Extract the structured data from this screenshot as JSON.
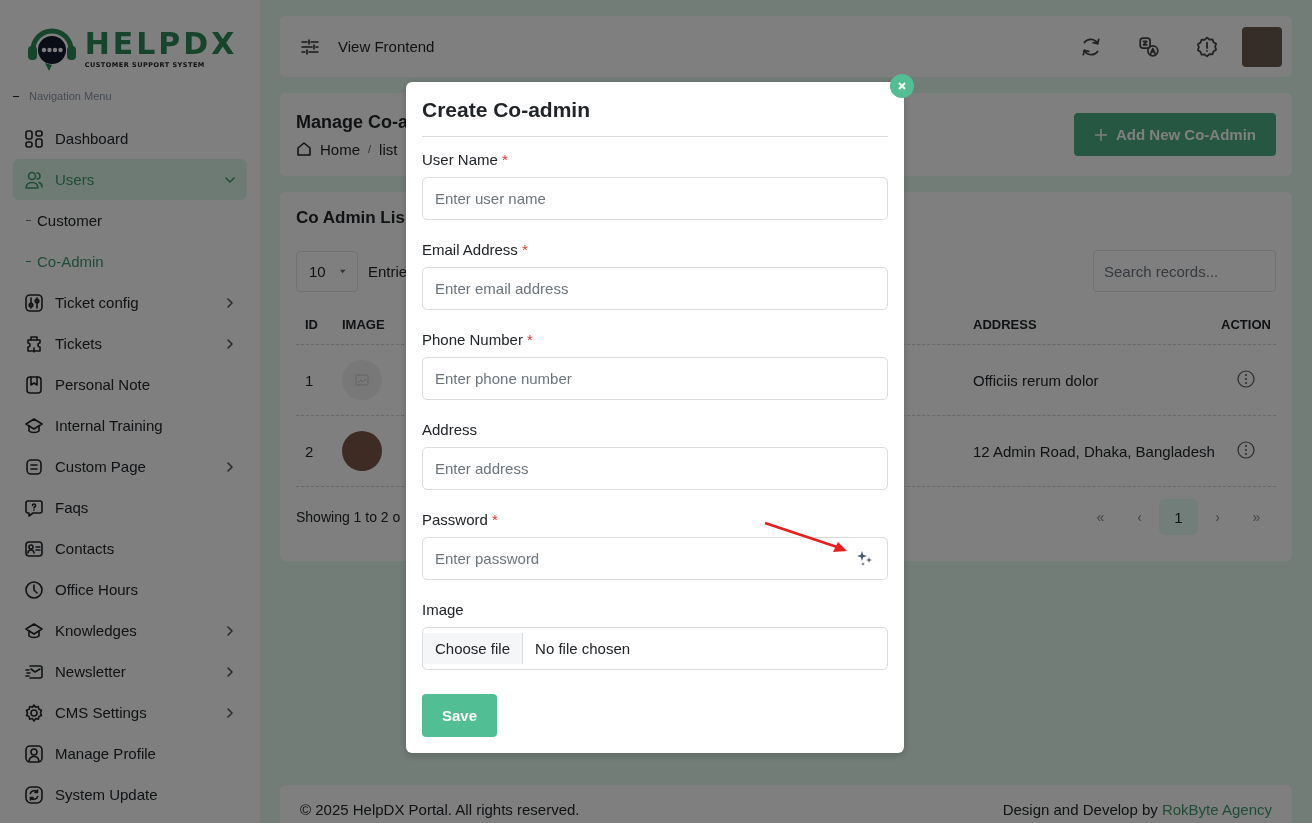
{
  "logo": {
    "name": "HELPDX",
    "tagline": "CUSTOMER SUPPORT SYSTEM"
  },
  "sidebar": {
    "heading": "Navigation Menu",
    "items": [
      {
        "label": "Dashboard",
        "selected": false,
        "has_submenu": false
      },
      {
        "label": "Users",
        "selected": true,
        "has_submenu": true,
        "expanded": true,
        "children": [
          {
            "label": "Customer",
            "selected": false
          },
          {
            "label": "Co-Admin",
            "selected": true
          }
        ]
      },
      {
        "label": "Ticket config",
        "selected": false,
        "has_submenu": true,
        "expanded": false
      },
      {
        "label": "Tickets",
        "selected": false,
        "has_submenu": true,
        "expanded": false
      },
      {
        "label": "Personal Note",
        "selected": false,
        "has_submenu": false
      },
      {
        "label": "Internal Training",
        "selected": false,
        "has_submenu": false
      },
      {
        "label": "Custom Page",
        "selected": false,
        "has_submenu": true,
        "expanded": false
      },
      {
        "label": "Faqs",
        "selected": false,
        "has_submenu": false
      },
      {
        "label": "Contacts",
        "selected": false,
        "has_submenu": false
      },
      {
        "label": "Office Hours",
        "selected": false,
        "has_submenu": false
      },
      {
        "label": "Knowledges",
        "selected": false,
        "has_submenu": true,
        "expanded": false
      },
      {
        "label": "Newsletter",
        "selected": false,
        "has_submenu": true,
        "expanded": false
      },
      {
        "label": "CMS Settings",
        "selected": false,
        "has_submenu": true,
        "expanded": false
      },
      {
        "label": "Manage Profile",
        "selected": false,
        "has_submenu": false
      },
      {
        "label": "System Update",
        "selected": false,
        "has_submenu": false
      }
    ]
  },
  "topbar": {
    "link": "View Frontend"
  },
  "page_header": {
    "title": "Manage Co-a",
    "breadcrumb": [
      "Home",
      "list"
    ],
    "breadcrumb_separator": "/",
    "button": "Add New Co-Admin"
  },
  "list": {
    "title": "Co Admin Lis",
    "page_size": "10",
    "entries_label": "Entrie",
    "search_placeholder": "Search records...",
    "table": {
      "columns": [
        "ID",
        "IMAGE",
        "ADDRESS",
        "ACTION"
      ],
      "rows": [
        {
          "id": "1",
          "kind": "placeholder",
          "address": "Officiis rerum dolor"
        },
        {
          "id": "2",
          "kind": "photo",
          "address": "12 Admin Road, Dhaka, Bangladesh"
        }
      ]
    },
    "summary": "Showing 1 to 2 o",
    "pagination": [
      {
        "label": "«",
        "selected": false
      },
      {
        "label": "‹",
        "selected": false
      },
      {
        "label": "1",
        "selected": true
      },
      {
        "label": "›",
        "selected": false
      },
      {
        "label": "»",
        "selected": false
      }
    ]
  },
  "footer": {
    "copyright": "© 2025 HelpDX Portal. All rights reserved.",
    "credit": "Design and Develop by",
    "credit_link": "RokByte Agency"
  },
  "modal": {
    "title": "Create Co-admin",
    "fields": [
      {
        "kind": "text",
        "label": "User Name",
        "required_mark": "*",
        "placeholder": "Enter user name"
      },
      {
        "kind": "text",
        "label": "Email Address",
        "required_mark": "*",
        "placeholder": "Enter email address"
      },
      {
        "kind": "text",
        "label": "Phone Number",
        "required_mark": "*",
        "placeholder": "Enter phone number"
      },
      {
        "kind": "text",
        "label": "Address",
        "placeholder": "Enter address"
      },
      {
        "kind": "password",
        "label": "Password",
        "required_mark": "*",
        "placeholder": "Enter password"
      },
      {
        "kind": "file",
        "label": "Image",
        "button": "Choose file",
        "value": "No file chosen"
      }
    ],
    "submit": "Save"
  }
}
